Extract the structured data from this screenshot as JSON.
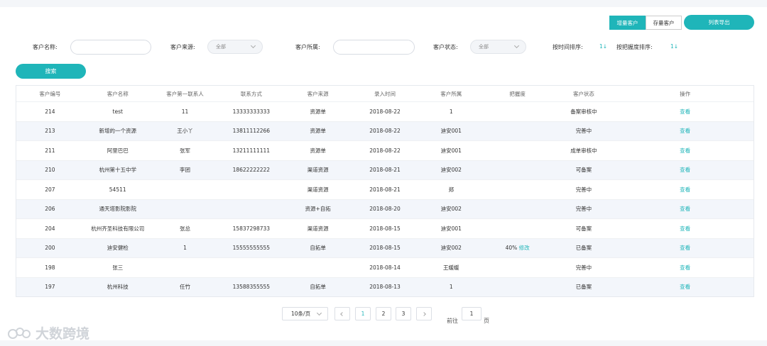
{
  "toggle": {
    "increment": "增量客户",
    "stock": "存量客户"
  },
  "export_label": "列表导出",
  "filters": {
    "name_label": "客户名称:",
    "source_label": "客户来源:",
    "source_value": "全部",
    "owner_label": "客户所属:",
    "status_label": "客户状态:",
    "status_value": "全部",
    "time_sort_label": "按时间排序:",
    "time_sort_value": "1↓",
    "grasp_sort_label": "按把握度排序:",
    "grasp_sort_value": "1↓"
  },
  "search_label": "搜索",
  "table": {
    "headers": [
      "客户编号",
      "客户名称",
      "客户第一联系人",
      "联系方式",
      "客户来源",
      "录入时间",
      "客户所属",
      "把握度",
      "客户状态",
      "操作"
    ],
    "rows": [
      [
        "214",
        "test",
        "11",
        "13333333333",
        "资源单",
        "2018-08-22",
        "1",
        "",
        "备案审核中",
        "查看"
      ],
      [
        "213",
        "新增的一个资源",
        "王小丫",
        "13811112266",
        "资源单",
        "2018-08-22",
        "迪安001",
        "",
        "完善中",
        "查看"
      ],
      [
        "211",
        "阿里巴巴",
        "张军",
        "13211111111",
        "资源单",
        "2018-08-22",
        "迪安001",
        "",
        "成单审核中",
        "查看"
      ],
      [
        "210",
        "杭州第十五中学",
        "李团",
        "18622222222",
        "渠道资源",
        "2018-08-21",
        "迪安002",
        "",
        "可备案",
        "查看"
      ],
      [
        "207",
        "54511",
        "",
        "",
        "渠道资源",
        "2018-08-21",
        "郑",
        "",
        "完善中",
        "查看"
      ],
      [
        "206",
        "通天塔影院影院",
        "",
        "",
        "资源+自拓",
        "2018-08-20",
        "迪安002",
        "",
        "完善中",
        "查看"
      ],
      [
        "204",
        "杭州齐圣科技有限公司",
        "张总",
        "15837298733",
        "渠道资源",
        "2018-08-15",
        "迪安001",
        "",
        "可备案",
        "查看"
      ],
      [
        "200",
        "迪安健检",
        "1",
        "15555555555",
        "自拓单",
        "2018-08-15",
        "迪安002",
        "40%",
        "已备案",
        "查看"
      ],
      [
        "198",
        "张三",
        "",
        "",
        "",
        "2018-08-14",
        "王缓缓",
        "",
        "完善中",
        "查看"
      ],
      [
        "197",
        "杭州科技",
        "任竹",
        "13588355555",
        "自拓单",
        "2018-08-13",
        "1",
        "",
        "已备案",
        "查看"
      ]
    ],
    "edit_label": "修改"
  },
  "pagination": {
    "page_size": "10条/页",
    "pages": [
      "1",
      "2",
      "3"
    ],
    "goto_prefix": "前往",
    "goto_value": "1",
    "goto_suffix": "页"
  },
  "watermark": "大数跨境",
  "colors": {
    "accent": "#1fb5b9"
  }
}
